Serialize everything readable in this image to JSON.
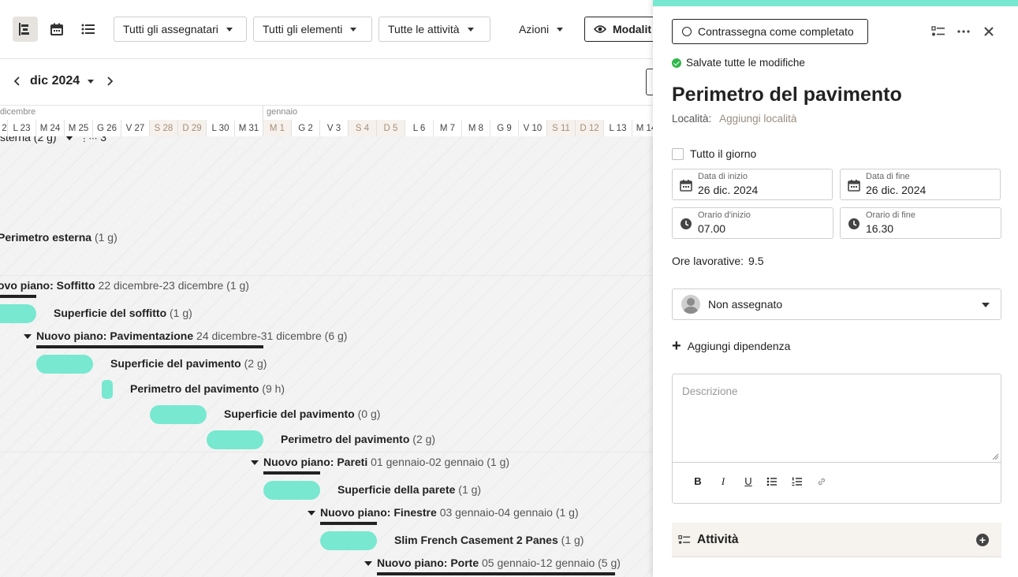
{
  "toolbar": {
    "filter_assignees": "Tutti gli assegnatari",
    "filter_elements": "Tutti gli elementi",
    "filter_activities": "Tutte le attività",
    "actions": "Azioni",
    "mode_button": "Modalit"
  },
  "nav": {
    "month": "dic 2024"
  },
  "timeline": {
    "months": [
      "dicembre",
      "gennaio"
    ],
    "days": [
      {
        "label": "L 23",
        "we": false
      },
      {
        "label": "M 24",
        "we": false
      },
      {
        "label": "M 25",
        "we": false
      },
      {
        "label": "G 26",
        "we": false
      },
      {
        "label": "V 27",
        "we": false
      },
      {
        "label": "S 28",
        "we": true
      },
      {
        "label": "D 29",
        "we": true
      },
      {
        "label": "L 30",
        "we": false
      },
      {
        "label": "M 31",
        "we": false
      },
      {
        "label": "M 1",
        "we": true
      },
      {
        "label": "G 2",
        "we": false
      },
      {
        "label": "V 3",
        "we": false
      },
      {
        "label": "S 4",
        "we": true
      },
      {
        "label": "D 5",
        "we": true
      },
      {
        "label": "L 6",
        "we": false
      },
      {
        "label": "M 7",
        "we": false
      },
      {
        "label": "M 8",
        "we": false
      },
      {
        "label": "G 9",
        "we": false
      },
      {
        "label": "V 10",
        "we": false
      },
      {
        "label": "S 11",
        "we": true
      },
      {
        "label": "D 12",
        "we": true
      },
      {
        "label": "L 13",
        "we": false
      },
      {
        "label": "M 14",
        "we": false
      }
    ],
    "first_day_partial": "2"
  },
  "gantt": {
    "top_partial": "sterna (2 g)",
    "top_partial_count": "3",
    "perimetro_esterna": {
      "name": "Perimetro esterna",
      "dur": "(1 g)"
    },
    "group_soffitto": {
      "name": "ovo piano: Soffitto",
      "dates": "22 dicembre-23 dicembre (1 g)"
    },
    "superficie_soffitto": {
      "name": "Superficie del soffitto",
      "dur": "(1 g)"
    },
    "group_pavimentazione": {
      "name": "Nuovo piano: Pavimentazione",
      "dates": "24 dicembre-31 dicembre (6 g)"
    },
    "superficie_pav_1": {
      "name": "Superficie del pavimento",
      "dur": "(2 g)"
    },
    "perimetro_pav_1": {
      "name": "Perimetro del pavimento",
      "dur": "(9 h)"
    },
    "superficie_pav_2": {
      "name": "Superficie del pavimento",
      "dur": "(0 g)"
    },
    "perimetro_pav_2": {
      "name": "Perimetro del pavimento",
      "dur": "(2 g)"
    },
    "group_pareti": {
      "name": "Nuovo piano: Pareti",
      "dates": "01 gennaio-02 gennaio (1 g)"
    },
    "superficie_parete": {
      "name": "Superficie della parete",
      "dur": "(1 g)"
    },
    "group_finestre": {
      "name": "Nuovo piano: Finestre",
      "dates": "03 gennaio-04 gennaio (1 g)"
    },
    "slim_french": {
      "name": "Slim French Casement 2 Panes",
      "dur": "(1 g)"
    },
    "group_porte": {
      "name": "Nuovo piano: Porte",
      "dates": "05 gennaio-12 gennaio (5 g)"
    }
  },
  "panel": {
    "complete_button": "Contrassegna come completato",
    "saved_status": "Salvate tutte le modifiche",
    "title": "Perimetro del pavimento",
    "location_label": "Località:",
    "location_link": "Aggiungi località",
    "all_day": "Tutto il giorno",
    "start_date_label": "Data di inizio",
    "start_date": "26 dic. 2024",
    "end_date_label": "Data di fine",
    "end_date": "26 dic. 2024",
    "start_time_label": "Orario d'inizio",
    "start_time": "07.00",
    "end_time_label": "Orario di fine",
    "end_time": "16.30",
    "work_hours_label": "Ore lavorative:",
    "work_hours": "9.5",
    "assignee": "Non assegnato",
    "add_dependency": "Aggiungi dipendenza",
    "description_placeholder": "Descrizione",
    "format": {
      "bold": "B",
      "italic": "I",
      "underline": "U"
    },
    "activities_title": "Attività"
  },
  "colors": {
    "bar": "#78e8d0",
    "accent": "#78e8d0",
    "saved": "#2fb84a"
  }
}
